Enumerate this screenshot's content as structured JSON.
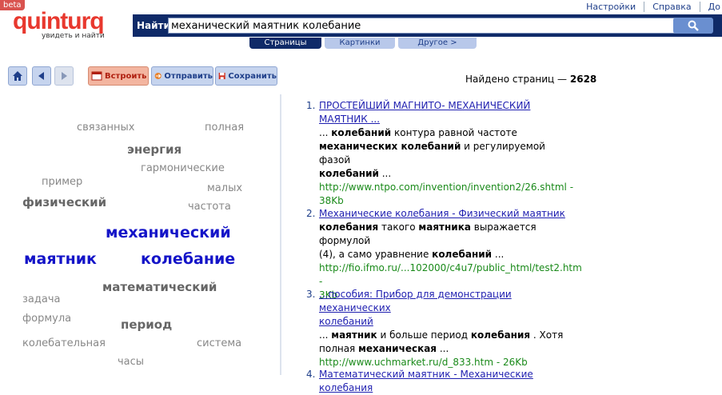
{
  "header": {
    "beta": "beta",
    "logo_text": "quinturq",
    "logo_tagline": "увидеть и найти",
    "top_links": [
      "Настройки",
      "Справка",
      "До"
    ],
    "find_label": "Найти",
    "search_value": "механический маятник колебание"
  },
  "tabs": [
    {
      "label": "Страницы",
      "active": true
    },
    {
      "label": "Картинки",
      "active": false
    },
    {
      "label": "Другое >",
      "active": false
    }
  ],
  "toolbar": {
    "embed": "Встроить",
    "send": "Отправить",
    "save": "Сохранить"
  },
  "cloud": [
    {
      "text": "связанных",
      "tier": "s"
    },
    {
      "text": "полная",
      "tier": "s"
    },
    {
      "text": "энергия",
      "tier": "m"
    },
    {
      "text": "гармонические",
      "tier": "s"
    },
    {
      "text": "пример",
      "tier": "s"
    },
    {
      "text": "малых",
      "tier": "s"
    },
    {
      "text": "физический",
      "tier": "m"
    },
    {
      "text": "частота",
      "tier": "s"
    },
    {
      "text": "механический",
      "tier": "l"
    },
    {
      "text": "маятник",
      "tier": "l"
    },
    {
      "text": "колебание",
      "tier": "l"
    },
    {
      "text": "математический",
      "tier": "m"
    },
    {
      "text": "задача",
      "tier": "s"
    },
    {
      "text": "формула",
      "tier": "s"
    },
    {
      "text": "период",
      "tier": "m"
    },
    {
      "text": "колебательная",
      "tier": "s"
    },
    {
      "text": "система",
      "tier": "s"
    },
    {
      "text": "часы",
      "tier": "s"
    }
  ],
  "results": {
    "found_label": "Найдено страниц —",
    "found_count": "2628",
    "items": [
      {
        "num": "1.",
        "title": [
          "ПРОСТЕЙШИЙ МАГНИТО- МЕХАНИЧЕСКИЙ",
          "МАЯТНИК ..."
        ],
        "snippet": [
          [
            {
              "t": "... ",
              "b": false
            },
            {
              "t": "колебаний",
              "b": true
            },
            {
              "t": " контура равной частоте",
              "b": false
            }
          ],
          [
            {
              "t": "механических колебаний",
              "b": true
            },
            {
              "t": " и регулируемой фазой",
              "b": false
            }
          ],
          [
            {
              "t": "колебаний",
              "b": true
            },
            {
              "t": " ...",
              "b": false
            }
          ]
        ],
        "url": [
          "http://www.ntpo.com/invention/invention2/26.shtml -",
          "38Kb"
        ]
      },
      {
        "num": "2.",
        "title": [
          "Механические колебания - Физический маятник"
        ],
        "snippet": [
          [
            {
              "t": "колебания",
              "b": true
            },
            {
              "t": " такого ",
              "b": false
            },
            {
              "t": "маятника",
              "b": true
            },
            {
              "t": " выражается формулой",
              "b": false
            }
          ],
          [
            {
              "t": "(4), а само уравнение ",
              "b": false
            },
            {
              "t": "колебаний",
              "b": true
            },
            {
              "t": " ...",
              "b": false
            }
          ]
        ],
        "url": [
          "http://fio.ifmo.ru/...102000/c4u7/public_html/test2.htm -",
          "3Kb"
        ]
      },
      {
        "num": "3.",
        "title": [
          "...пособия: Прибор для демонстрации механических",
          "колебаний"
        ],
        "snippet": [
          [
            {
              "t": "... ",
              "b": false
            },
            {
              "t": "маятник",
              "b": true
            },
            {
              "t": " и больше период ",
              "b": false
            },
            {
              "t": "колебания",
              "b": true
            },
            {
              "t": " . Хотя",
              "b": false
            }
          ],
          [
            {
              "t": "полная ",
              "b": false
            },
            {
              "t": "механическая",
              "b": true
            },
            {
              "t": " ...",
              "b": false
            }
          ]
        ],
        "url": [
          "http://www.uchmarket.ru/d_833.htm - 26Kb"
        ]
      },
      {
        "num": "4.",
        "title": [
          "Математический маятник - Механические колебания"
        ],
        "snippet": [],
        "url": []
      }
    ]
  },
  "colors": {
    "navy": "#0f2a68",
    "link": "#1f1fb0",
    "url": "#1a8a1a",
    "brand_red": "#e8382e",
    "cloud_large": "#1414c8",
    "cloud_medium": "#666666",
    "cloud_small": "#888888"
  }
}
